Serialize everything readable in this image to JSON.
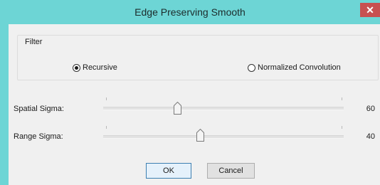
{
  "window": {
    "title": "Edge Preserving Smooth",
    "close_glyph": "✕"
  },
  "filter": {
    "group_label": "Filter",
    "options": [
      {
        "label": "Recursive",
        "selected": true
      },
      {
        "label": "Normalized Convolution",
        "selected": false
      }
    ]
  },
  "sliders": [
    {
      "label": "Spatial Sigma:",
      "value": "60",
      "position_fraction": 0.31
    },
    {
      "label": "Range Sigma:",
      "value": "40",
      "position_fraction": 0.41
    }
  ],
  "buttons": {
    "ok_label": "OK",
    "cancel_label": "Cancel"
  },
  "colors": {
    "titlebar": "#6dd5d5",
    "close": "#c75050",
    "client": "#f0f0f0",
    "default_button_border": "#3c7fb1"
  }
}
